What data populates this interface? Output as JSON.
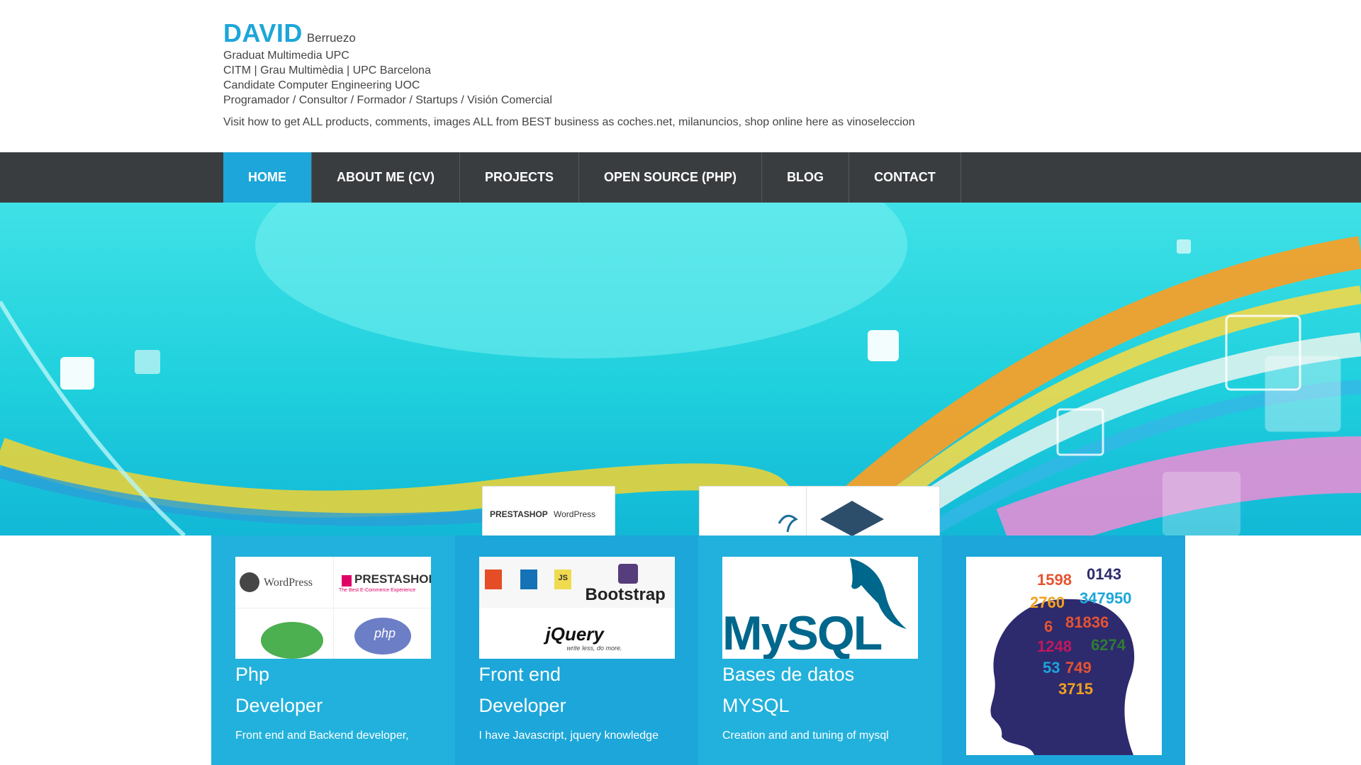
{
  "header": {
    "first_name": "DAVID",
    "last_name": "Berruezo",
    "lines": [
      "Graduat Multimedia UPC",
      "CITM | Grau Multimèdia | UPC Barcelona",
      "Candidate Computer Engineering UOC",
      "Programador / Consultor / Formador / Startups / Visión Comercial"
    ],
    "visit_text": "Visit how to get ALL products, comments, images ALL from BEST business as coches.net, milanuncios, shop online here as vinoseleccion"
  },
  "nav": {
    "items": [
      {
        "label": "HOME",
        "active": true
      },
      {
        "label": "ABOUT ME (CV)",
        "active": false
      },
      {
        "label": "PROJECTS",
        "active": false
      },
      {
        "label": "OPEN SOURCE (PHP)",
        "active": false
      },
      {
        "label": "BLOG",
        "active": false
      },
      {
        "label": "CONTACT",
        "active": false
      }
    ]
  },
  "hero": {
    "thumb1": {
      "logo_left": "PRESTASHOP",
      "logo_right": "WordPress"
    }
  },
  "cards": [
    {
      "title_1": "Php",
      "title_2": "Developer",
      "desc": "Front end and Backend developer,",
      "logos": [
        "WordPress",
        "PRESTASHOP",
        "The Best E-Commerce Experience",
        "php"
      ]
    },
    {
      "title_1": "Front end",
      "title_2": "Developer",
      "desc": "I have Javascript, jquery knowledge",
      "logos": [
        "Bootstrap",
        "jQuery",
        "write less, do more.",
        "JS"
      ]
    },
    {
      "title_1": "Bases de datos",
      "title_2": "MYSQL",
      "desc": "Creation and and tuning of mysql",
      "logos": [
        "MySQL"
      ]
    },
    {
      "title_1": "",
      "title_2": "",
      "desc": "",
      "logos": []
    }
  ],
  "colors": {
    "accent": "#1ca6d9",
    "nav_bg": "#3a3d40",
    "card": "#22b1dc"
  }
}
